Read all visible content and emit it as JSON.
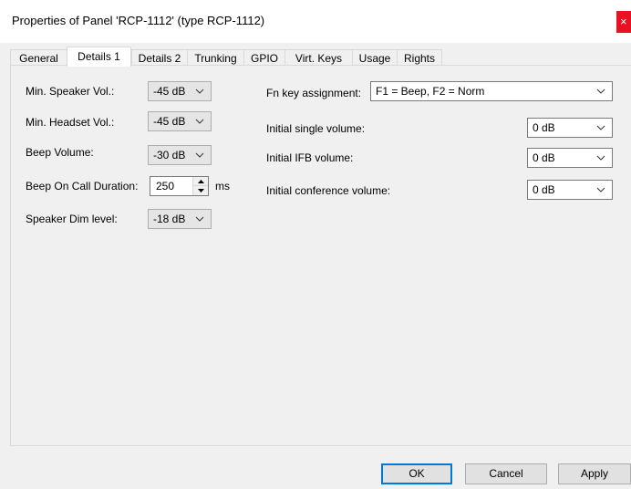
{
  "window": {
    "title": "Properties of Panel 'RCP-1112' (type RCP-1112)",
    "close_glyph": "×",
    "close_color": "#e81123"
  },
  "tabs": [
    {
      "label": "General"
    },
    {
      "label": "Details 1",
      "active": true
    },
    {
      "label": "Details 2"
    },
    {
      "label": "Trunking"
    },
    {
      "label": "GPIO"
    },
    {
      "label": "Virt. Keys"
    },
    {
      "label": "Usage"
    },
    {
      "label": "Rights"
    }
  ],
  "left": {
    "min_speaker_vol": {
      "label": "Min. Speaker Vol.:",
      "value": "-45 dB"
    },
    "min_headset_vol": {
      "label": "Min. Headset Vol.:",
      "value": "-45 dB"
    },
    "beep_volume": {
      "label": "Beep Volume:",
      "value": "-30 dB"
    },
    "beep_on_call_duration": {
      "label": "Beep On Call Duration:",
      "value": "250",
      "unit": "ms"
    },
    "speaker_dim_level": {
      "label": "Speaker Dim level:",
      "value": "-18 dB"
    }
  },
  "right": {
    "fn_key_assignment": {
      "label": "Fn key assignment:",
      "value": "F1 = Beep, F2 = Norm"
    },
    "initial_single_volume": {
      "label": "Initial single volume:",
      "value": "0 dB"
    },
    "initial_ifb_volume": {
      "label": "Initial IFB volume:",
      "value": "0 dB"
    },
    "initial_conference_volume": {
      "label": "Initial conference volume:",
      "value": "0 dB"
    }
  },
  "buttons": {
    "ok": "OK",
    "cancel": "Cancel",
    "apply": "Apply"
  }
}
